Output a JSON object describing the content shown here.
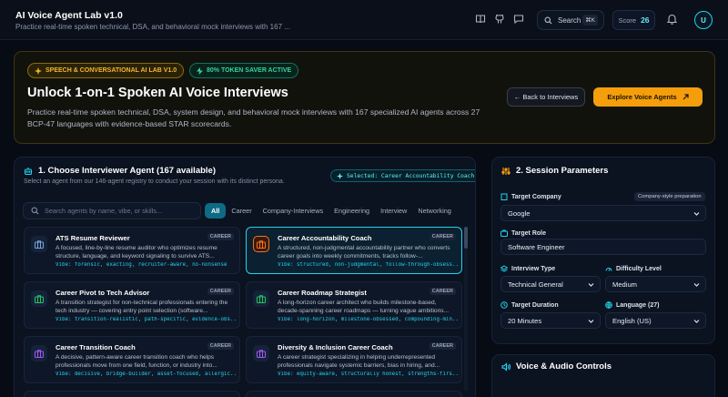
{
  "header": {
    "title": "AI Voice Agent Lab v1.0",
    "subtitle": "Practice real-time spoken technical, DSA, and behavioral mock interviews with 167 ...",
    "search_label": "Search",
    "search_shortcut": "⌘K",
    "score_label": "Score",
    "score_value": "26",
    "avatar_initial": "U",
    "icons": [
      "book-icon",
      "github-icon",
      "chat-icon",
      "search-icon",
      "bell-icon"
    ]
  },
  "hero": {
    "badge_lab": "SPEECH & CONVERSATIONAL AI LAB V1.0",
    "badge_token": "80% TOKEN SAVER ACTIVE",
    "title": "Unlock 1-on-1 Spoken AI Voice Interviews",
    "description": "Practice real-time spoken technical, DSA, system design, and behavioral mock interviews with 167 specialized AI agents across 27 BCP-47 languages with evidence-based STAR scorecards.",
    "back_button": "← Back to Interviews",
    "explore_button": "Explore Voice Agents",
    "colors": {
      "accent": "#f59e0b",
      "success": "#34d399"
    }
  },
  "agents_panel": {
    "title": "1. Choose Interviewer Agent (167 available)",
    "subtitle": "Select an agent from our 146-agent registry to conduct your session with its distinct persona.",
    "selected_badge": "Selected: Career Accountability Coach",
    "search_placeholder": "Search agents by name, vibe, or skills...",
    "filters": [
      "All",
      "Career",
      "Company-Interviews",
      "Engineering",
      "Interview",
      "Networking"
    ],
    "active_filter": "All",
    "agents": [
      {
        "name": "ATS Resume Reviewer",
        "tag": "CAREER",
        "description": "A focused, line-by-line resume auditor who optimizes resume structure, language, and keyword signaling to survive ATS...",
        "vibe": "Vibe: forensic, exacting, recruiter-aware, no-nonsense",
        "selected": false,
        "icon_color": "#7aa2d6"
      },
      {
        "name": "Career Accountability Coach",
        "tag": "CAREER",
        "description": "A structured, non-judgmental accountability partner who converts career goals into weekly commitments, tracks follow-...",
        "vibe": "Vibe: structured, non-judgmental, follow-through-obsess...",
        "selected": true,
        "icon_color": "#f97316"
      },
      {
        "name": "Career Pivot to Tech Advisor",
        "tag": "CAREER",
        "description": "A transition strategist for non-technical professionals entering the tech industry — covering entry point selection (software...",
        "vibe": "Vibe: transition-realistic, path-specific, evidence-obs...",
        "selected": false,
        "icon_color": "#22c55e"
      },
      {
        "name": "Career Roadmap Strategist",
        "tag": "CAREER",
        "description": "A long-horizon career architect who builds milestone-based, decade-spanning career roadmaps — turning vague ambitions...",
        "vibe": "Vibe: long-horizon, milestone-obsessed, compounding-min...",
        "selected": false,
        "icon_color": "#22c55e"
      },
      {
        "name": "Career Transition Coach",
        "tag": "CAREER",
        "description": "A decisive, pattern-aware career transition coach who helps professionals move from one field, function, or industry into...",
        "vibe": "Vibe: decisive, bridge-builder, asset-focused, allergic...",
        "selected": false,
        "icon_color": "#a855f7"
      },
      {
        "name": "Diversity & Inclusion Career Coach",
        "tag": "CAREER",
        "description": "A career strategist specializing in helping underrepresented professionals navigate systemic barriers, bias in hiring, and...",
        "vibe": "Vibe: equity-aware, structurally honest, strengths-firs...",
        "selected": false,
        "icon_color": "#a855f7"
      }
    ]
  },
  "session_panel": {
    "title": "2. Session Parameters",
    "company_label": "Target Company",
    "company_hint": "Company-style preparation",
    "company_value": "Google",
    "role_label": "Target Role",
    "role_value": "Software Engineer",
    "type_label": "Interview Type",
    "type_value": "Technical General",
    "difficulty_label": "Difficulty Level",
    "difficulty_value": "Medium",
    "duration_label": "Target Duration",
    "duration_value": "20 Minutes",
    "language_label": "Language (27)",
    "language_value": "English (US)"
  },
  "voice_panel": {
    "title": "Voice & Audio Controls"
  }
}
